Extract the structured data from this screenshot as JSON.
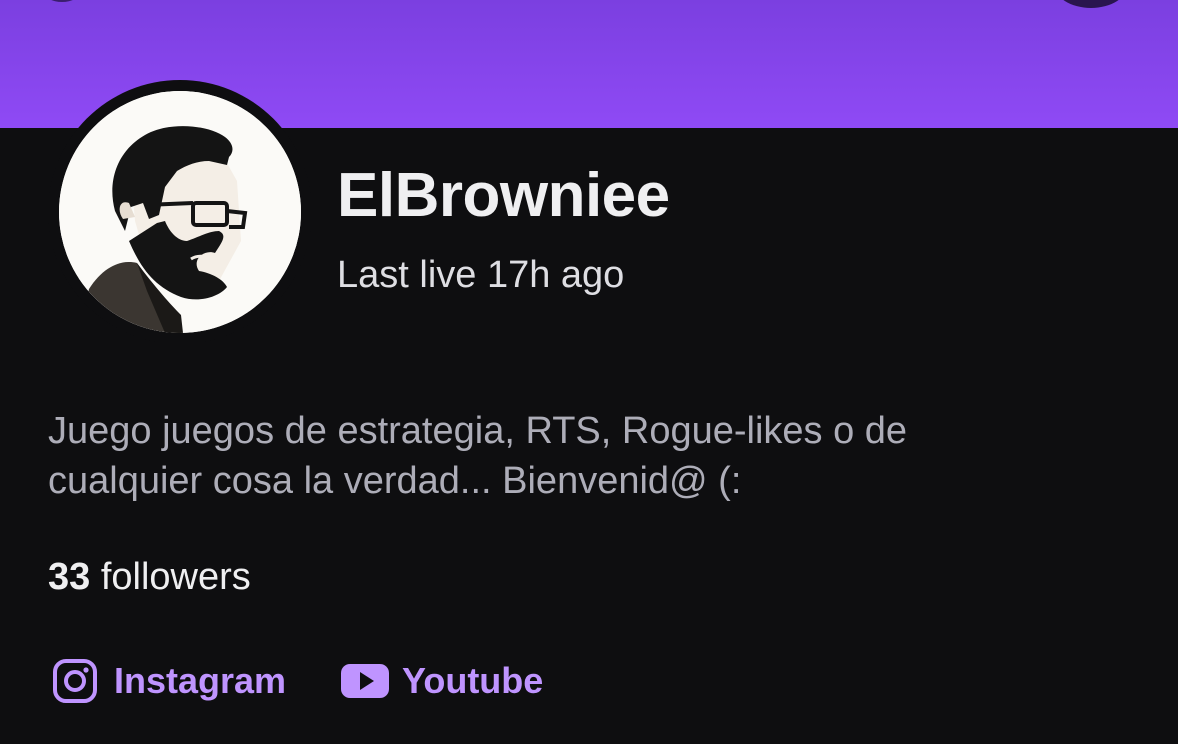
{
  "profile": {
    "channel_name": "ElBrowniee",
    "last_live": "Last live 17h ago",
    "bio_line1": "Juego juegos de estrategia, RTS, Rogue-likes o de",
    "bio_line2": "cualquier cosa la verdad... Bienvenid@ (:",
    "followers_count": "33",
    "followers_label": "followers"
  },
  "social_links": [
    {
      "label": "Instagram",
      "icon": "instagram-icon"
    },
    {
      "label": "Youtube",
      "icon": "youtube-icon"
    }
  ],
  "colors": {
    "banner": "#8f4af5",
    "background": "#0e0e10",
    "link": "#bf94ff",
    "primary_text": "#efeff1",
    "secondary_text": "#adadb8"
  }
}
